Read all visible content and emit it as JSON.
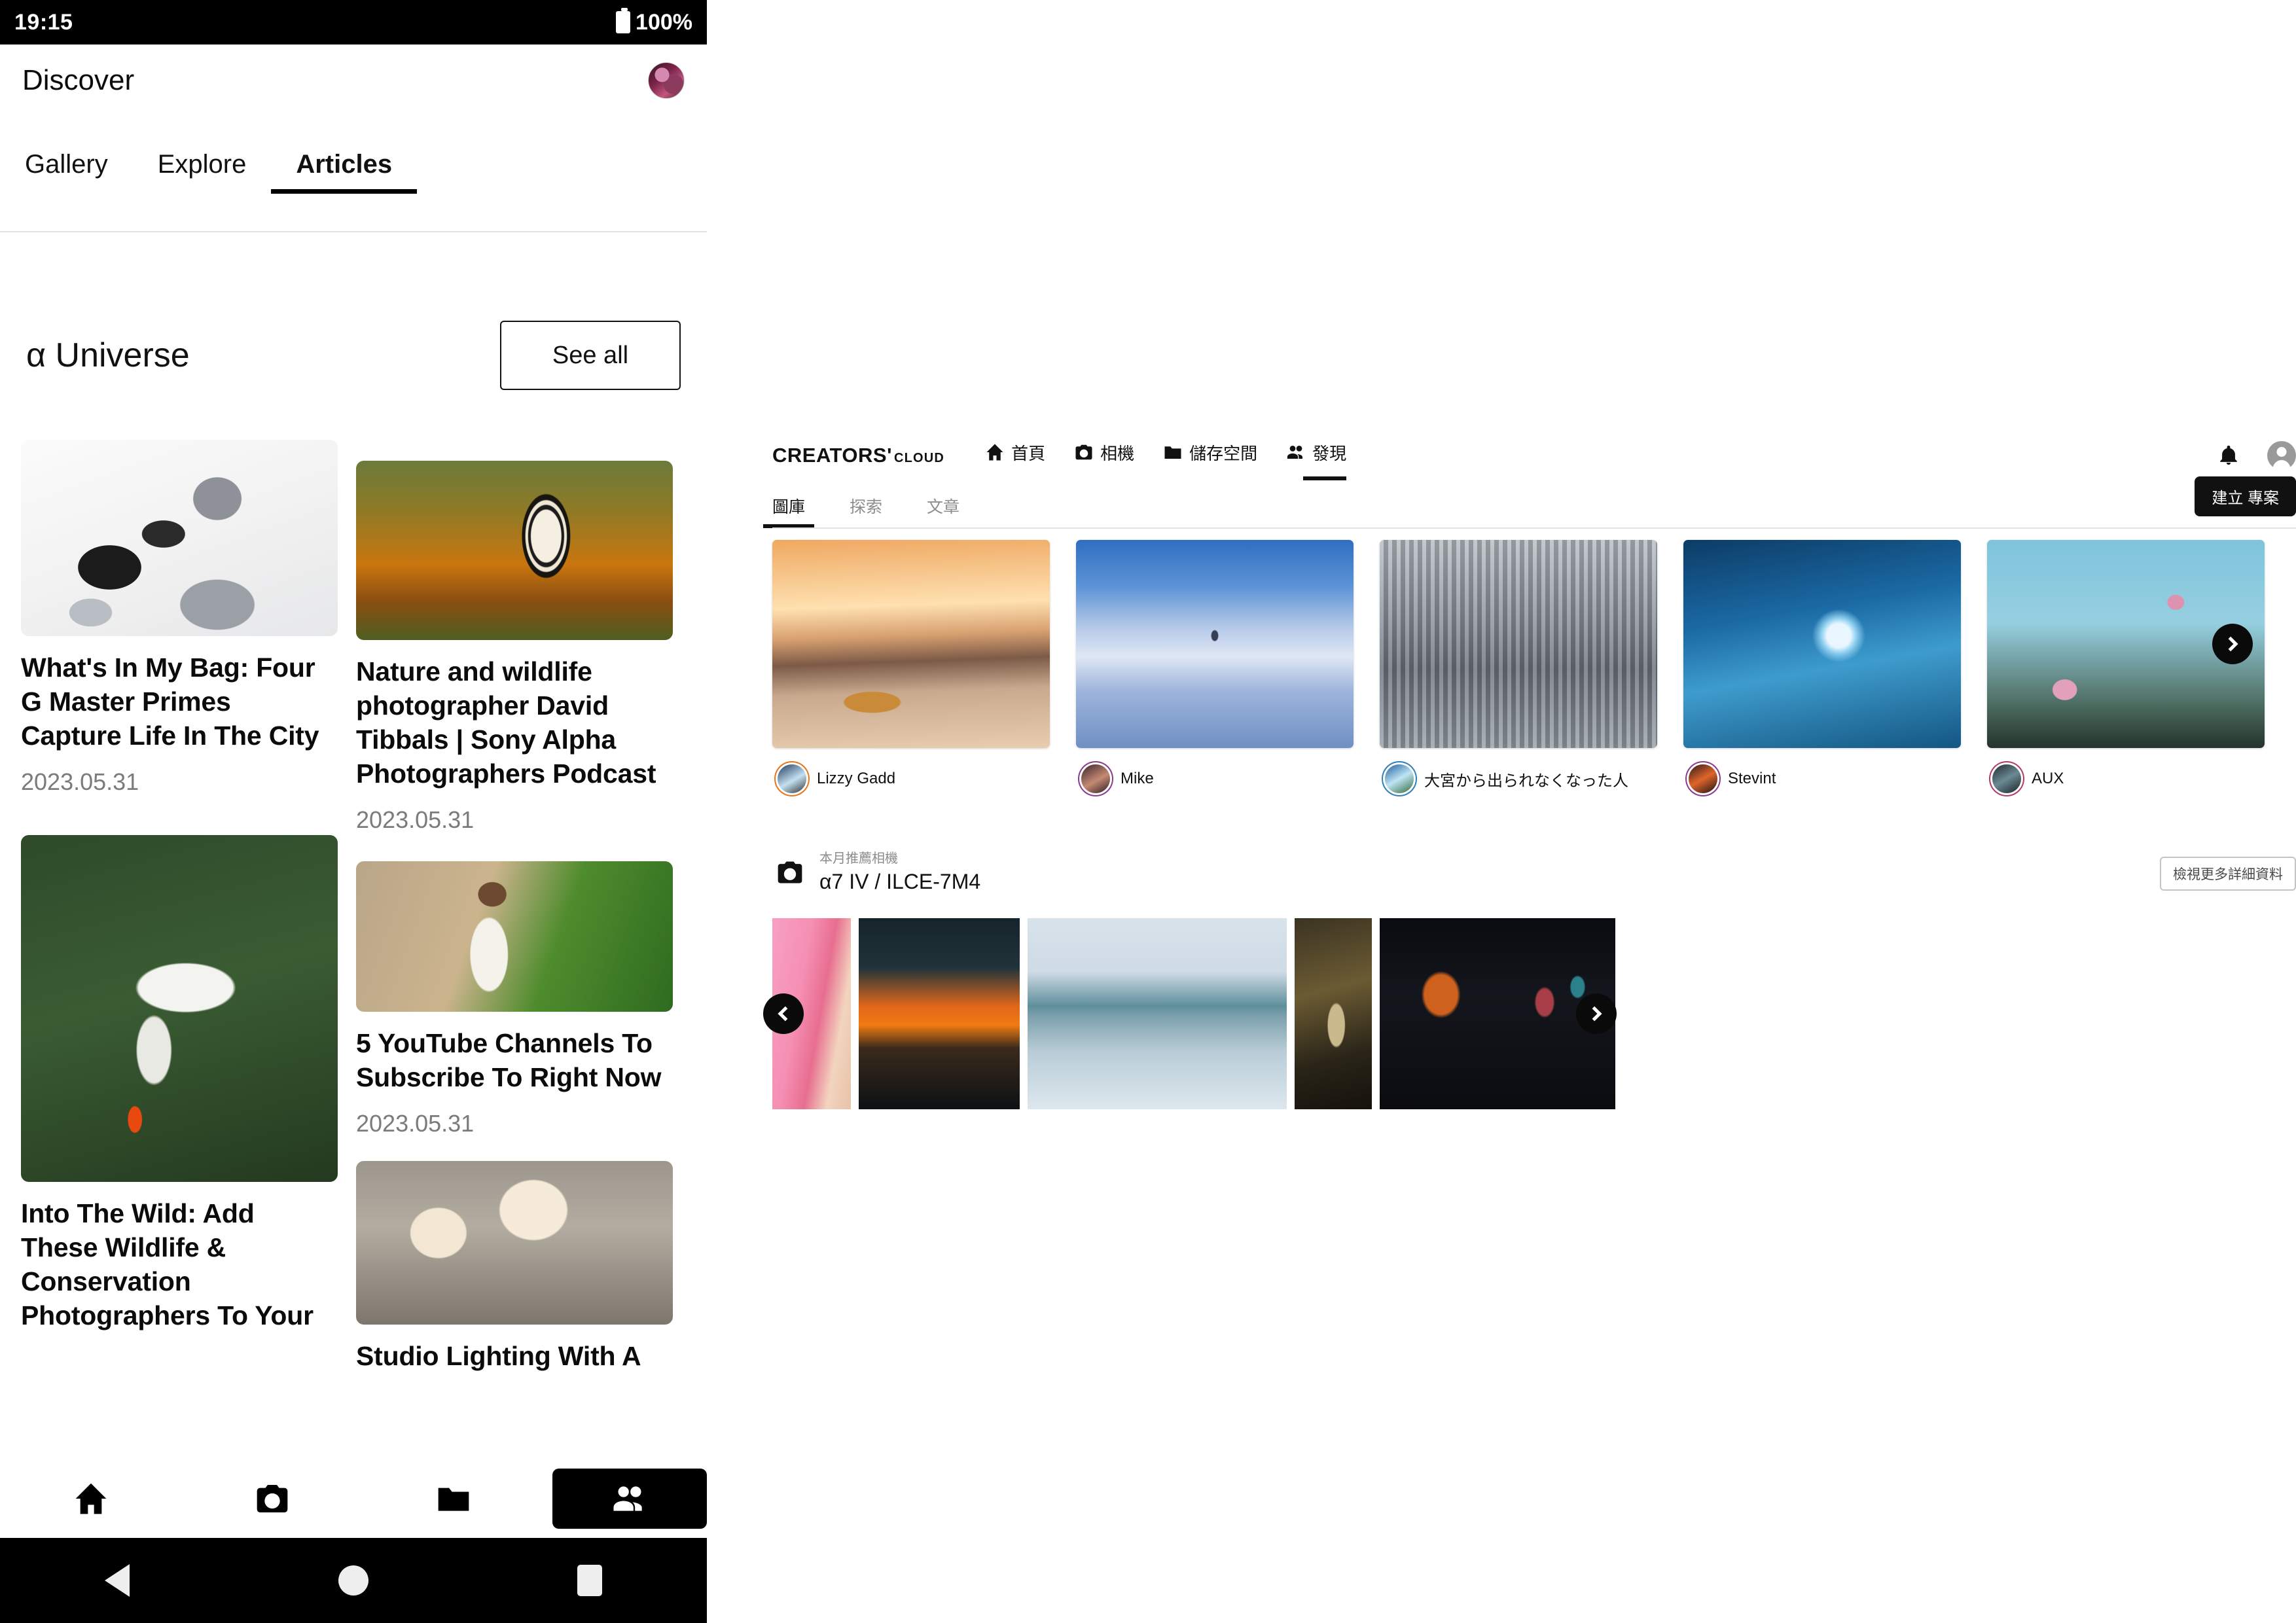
{
  "mobile": {
    "status_bar": {
      "time": "19:15",
      "battery": "100%",
      "battery_icon": "battery-full-icon"
    },
    "app_bar": {
      "title": "Discover",
      "avatar_icon": "user-avatar"
    },
    "tabs": [
      {
        "label": "Gallery",
        "active": false
      },
      {
        "label": "Explore",
        "active": false
      },
      {
        "label": "Articles",
        "active": true
      }
    ],
    "section": {
      "title": "α Universe",
      "see_all_label": "See all"
    },
    "articles_left": [
      {
        "title": "What's In My Bag: Four G Master Primes Capture Life In The City",
        "date": "2023.05.31",
        "image": "camera-bag-flatlay"
      },
      {
        "title": "Into The Wild: Add These Wildlife & Conservation Photographers To Your",
        "date": "",
        "image": "tern-bird-in-flight"
      }
    ],
    "articles_right": [
      {
        "title": "Nature and wildlife photographer David Tibbals | Sony Alpha Photographers Podcast",
        "date": "2023.05.31",
        "image": "zebra-in-grassland"
      },
      {
        "title": "5 YouTube Channels To Subscribe To Right Now",
        "date": "2023.05.31",
        "image": "bride-with-bouquet"
      },
      {
        "title": "Studio Lighting With A",
        "date": "",
        "image": "studio-lighting-setup"
      }
    ],
    "bottom_nav": [
      {
        "icon": "home-icon",
        "active": false
      },
      {
        "icon": "camera-icon",
        "active": false
      },
      {
        "icon": "folder-icon",
        "active": false
      },
      {
        "icon": "people-icon",
        "active": true
      }
    ],
    "system_nav": [
      {
        "icon": "back-triangle-icon"
      },
      {
        "icon": "home-circle-icon"
      },
      {
        "icon": "recents-square-icon"
      }
    ]
  },
  "web": {
    "logo": {
      "main": "CREATORS'",
      "sub": "CLOUD"
    },
    "nav": [
      {
        "label": "首頁",
        "icon": "home-icon",
        "active": false
      },
      {
        "label": "相機",
        "icon": "camera-icon",
        "active": false
      },
      {
        "label": "儲存空間",
        "icon": "folder-icon",
        "active": false
      },
      {
        "label": "發現",
        "icon": "people-icon",
        "active": true
      }
    ],
    "header_actions": {
      "notification_icon": "bell-icon",
      "account_icon": "account-circle-icon",
      "create_project_label": "建立 專案"
    },
    "subtabs": [
      {
        "label": "圖庫",
        "active": true
      },
      {
        "label": "探索",
        "active": false
      },
      {
        "label": "文章",
        "active": false
      }
    ],
    "gallery": {
      "next_arrow_icon": "chevron-right-icon",
      "items": [
        {
          "author": "Lizzy Gadd",
          "image": "golden-sunrise-lake-kayak"
        },
        {
          "author": "Mike",
          "image": "lone-tree-frozen-lake"
        },
        {
          "author": "大宮から出られなくなった人",
          "image": "japanese-city-street"
        },
        {
          "author": "Stevint",
          "image": "blue-ice-cave"
        },
        {
          "author": "AUX",
          "image": "cherry-blossom-branches"
        }
      ]
    },
    "camera_section": {
      "icon": "camera-icon",
      "subtitle": "本月推薦相機",
      "name": "α7 IV / ILCE-7M4",
      "detail_button": "檢視更多詳細資料",
      "prev_arrow_icon": "chevron-left-icon",
      "next_arrow_icon": "chevron-right-icon",
      "photos": [
        "pink-minimal-portrait",
        "tokyo-tower-sunset",
        "city-puddle-reflection",
        "golden-archway",
        "neon-night-street"
      ]
    }
  }
}
